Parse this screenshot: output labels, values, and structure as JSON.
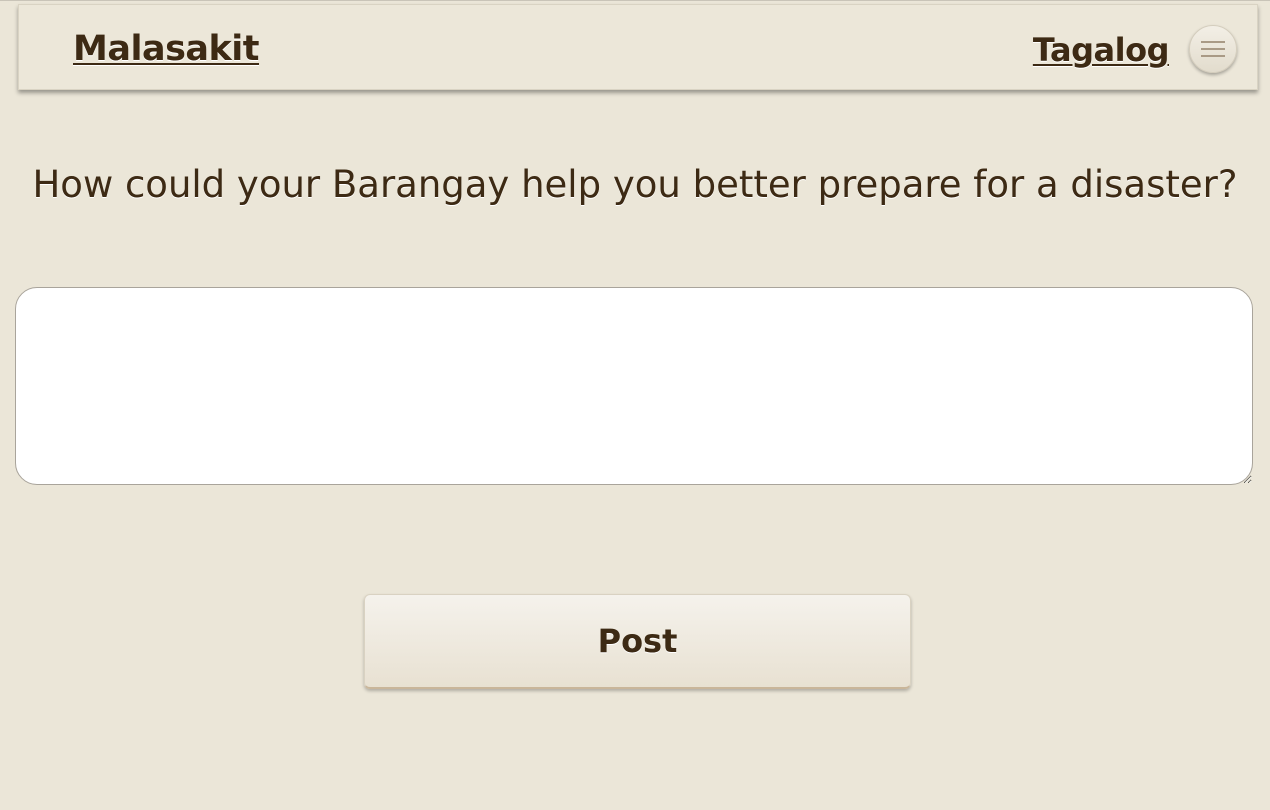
{
  "header": {
    "brand": "Malasakit",
    "language_link": "Tagalog",
    "menu_icon": "hamburger-menu-icon"
  },
  "main": {
    "question": "How could your Barangay help you better prepare for a disaster?",
    "answer_value": "",
    "answer_placeholder": "",
    "post_label": "Post"
  },
  "colors": {
    "background": "#ebe6d8",
    "text": "#3d2a14",
    "field": "#ffffff"
  }
}
